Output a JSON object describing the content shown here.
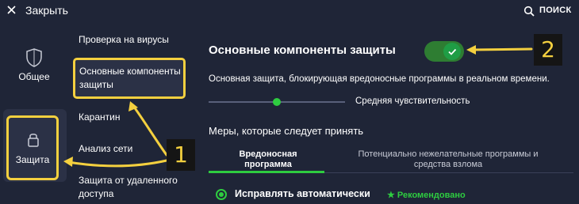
{
  "topbar": {
    "close_label": "Закрыть",
    "search_label": "ПОИСК"
  },
  "nav": {
    "general": "Общее",
    "protection": "Защита"
  },
  "submenu": {
    "virus_scan": "Проверка на вирусы",
    "core_shields": "Основные компоненты защиты",
    "quarantine": "Карантин",
    "network_inspector": "Анализ сети",
    "remote_access": "Защита от удаленного доступа"
  },
  "main": {
    "title": "Основные компоненты защиты",
    "toggle_on": true,
    "description": "Основная защита, блокирующая вредоносные программы в реальном времени.",
    "sensitivity_label": "Средняя чувствительность",
    "sensitivity_level": 0.5,
    "actions_title": "Меры, которые следует принять",
    "tabs": [
      {
        "label": "Вредоносная программа",
        "active": true
      },
      {
        "label": "Потенциально нежелательные программы и средства взлома",
        "active": false
      }
    ],
    "option_label": "Исправлять автоматически",
    "recommended_label": "★ Рекомендовано"
  },
  "callouts": {
    "one": "1",
    "two": "2"
  },
  "colors": {
    "background": "#1f2537",
    "accent_green": "#2ecc40",
    "highlight_yellow": "#f4d03f"
  }
}
